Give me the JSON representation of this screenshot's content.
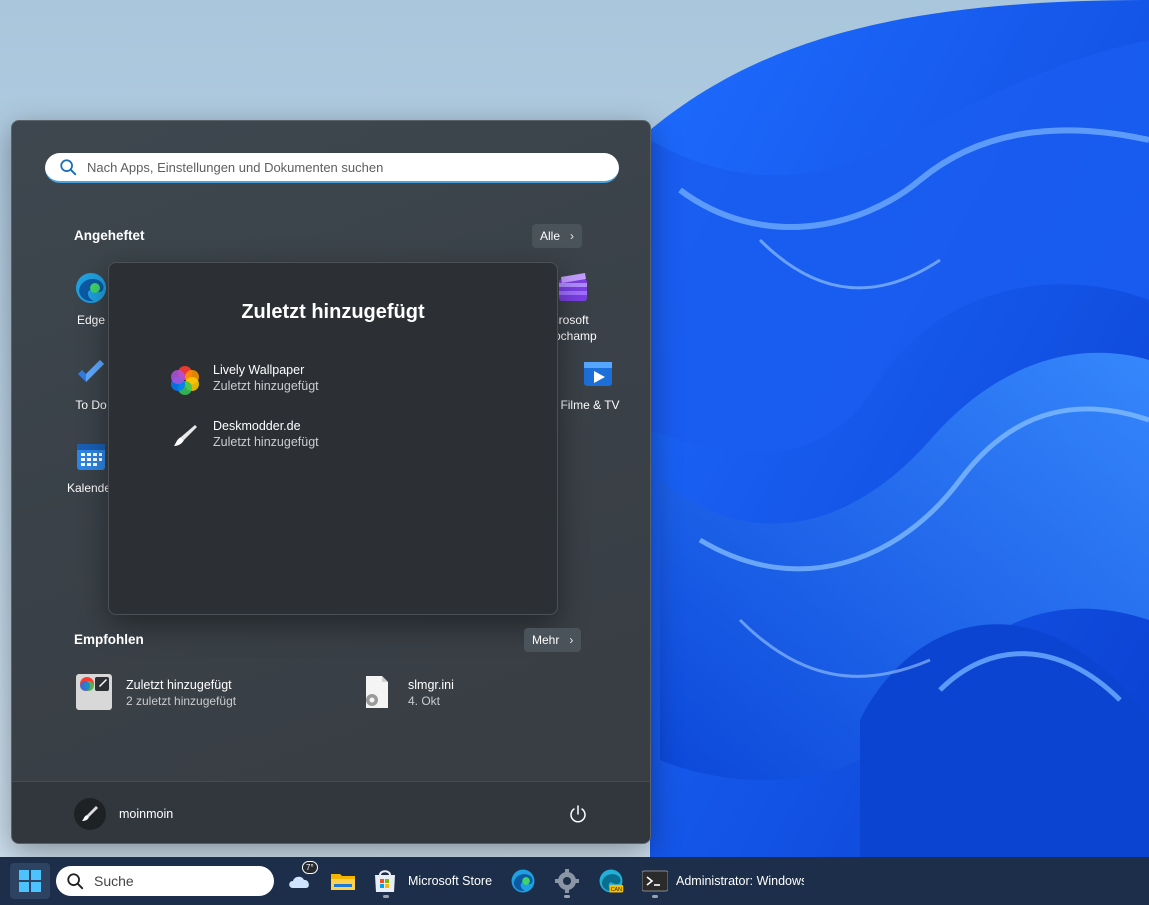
{
  "search": {
    "placeholder": "Nach Apps, Einstellungen und Dokumenten suchen"
  },
  "pinned": {
    "title": "Angeheftet",
    "all_label": "Alle",
    "apps": [
      {
        "label": "Edge"
      },
      {
        "label": "Microsoft\nClipchamp"
      },
      {
        "label": "To Do"
      },
      {
        "label": "Filme & TV"
      },
      {
        "label": "Kalender"
      }
    ]
  },
  "folder": {
    "title": "Zuletzt hinzugefügt",
    "items": [
      {
        "name": "Lively Wallpaper",
        "sub": "Zuletzt hinzugefügt"
      },
      {
        "name": "Deskmodder.de",
        "sub": "Zuletzt hinzugefügt"
      }
    ]
  },
  "recommended": {
    "title": "Empfohlen",
    "more_label": "Mehr",
    "items": [
      {
        "name": "Zuletzt hinzugefügt",
        "sub": "2 zuletzt hinzugefügt"
      },
      {
        "name": "slmgr.ini",
        "sub": "4. Okt"
      }
    ]
  },
  "user": {
    "name": "moinmoin"
  },
  "taskbar": {
    "search_label": "Suche",
    "weather_temp": "7°",
    "store_label": "Microsoft Store",
    "terminal_label": "Administrator: Windows",
    "canary_badge": "CAN"
  }
}
